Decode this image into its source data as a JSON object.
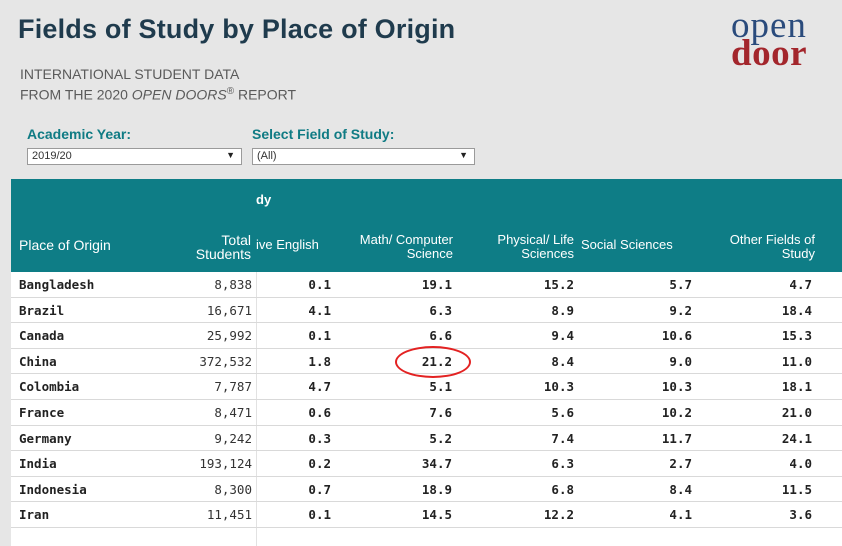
{
  "header": {
    "title": "Fields of Study by Place of Origin",
    "subtitle_line1": "INTERNATIONAL STUDENT DATA",
    "subtitle_line2_prefix": "FROM THE 2020 ",
    "subtitle_line2_italic": "OPEN DOORS",
    "subtitle_line2_reg": "®",
    "subtitle_line2_suffix": " REPORT",
    "logo_line1": "open",
    "logo_line2": "door"
  },
  "filters": {
    "academic_year_label": "Academic Year:",
    "academic_year_value": "2019/20",
    "field_label": "Select Field of Study:",
    "field_value": "(All)"
  },
  "table": {
    "group_header": "dy",
    "columns": [
      "Place of Origin",
      "Total",
      "Students",
      "ive English",
      "Math/ Computer",
      "Science",
      "Physical/ Life",
      "Sciences",
      "Social Sciences",
      "Other Fields of",
      "Study"
    ],
    "rows": [
      {
        "country": "Bangladesh",
        "total": "8,838",
        "c1": "0.1",
        "c2": "19.1",
        "c3": "15.2",
        "c4": "5.7",
        "c5": "4.7"
      },
      {
        "country": "Brazil",
        "total": "16,671",
        "c1": "4.1",
        "c2": "6.3",
        "c3": "8.9",
        "c4": "9.2",
        "c5": "18.4"
      },
      {
        "country": "Canada",
        "total": "25,992",
        "c1": "0.1",
        "c2": "6.6",
        "c3": "9.4",
        "c4": "10.6",
        "c5": "15.3"
      },
      {
        "country": "China",
        "total": "372,532",
        "c1": "1.8",
        "c2": "21.2",
        "c3": "8.4",
        "c4": "9.0",
        "c5": "11.0"
      },
      {
        "country": "Colombia",
        "total": "7,787",
        "c1": "4.7",
        "c2": "5.1",
        "c3": "10.3",
        "c4": "10.3",
        "c5": "18.1"
      },
      {
        "country": "France",
        "total": "8,471",
        "c1": "0.6",
        "c2": "7.6",
        "c3": "5.6",
        "c4": "10.2",
        "c5": "21.0"
      },
      {
        "country": "Germany",
        "total": "9,242",
        "c1": "0.3",
        "c2": "5.2",
        "c3": "7.4",
        "c4": "11.7",
        "c5": "24.1"
      },
      {
        "country": "India",
        "total": "193,124",
        "c1": "0.2",
        "c2": "34.7",
        "c3": "6.3",
        "c4": "2.7",
        "c5": "4.0"
      },
      {
        "country": "Indonesia",
        "total": "8,300",
        "c1": "0.7",
        "c2": "18.9",
        "c3": "6.8",
        "c4": "8.4",
        "c5": "11.5"
      },
      {
        "country": "Iran",
        "total": "11,451",
        "c1": "0.1",
        "c2": "14.5",
        "c3": "12.2",
        "c4": "4.1",
        "c5": "3.6"
      }
    ]
  },
  "colors": {
    "header_teal": "#0e7d86",
    "label_teal": "#0f7b84",
    "highlight_red": "#e32222"
  }
}
